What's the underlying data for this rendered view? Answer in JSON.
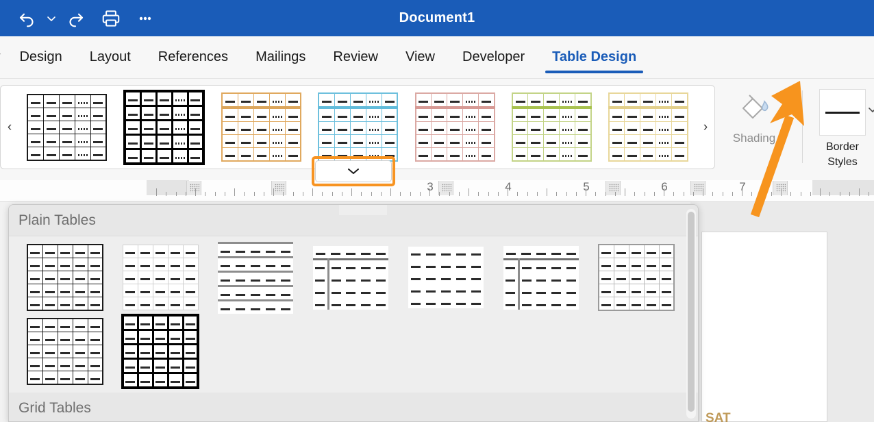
{
  "titlebar": {
    "document_title": "Document1",
    "background_color": "#1a5cb8",
    "quick_access": [
      {
        "name": "undo-icon",
        "label": "Undo"
      },
      {
        "name": "undo-dropdown-icon",
        "label": "Undo options"
      },
      {
        "name": "redo-icon",
        "label": "Redo"
      },
      {
        "name": "print-icon",
        "label": "Print"
      },
      {
        "name": "more-commands-icon",
        "label": "More"
      }
    ]
  },
  "tabs": {
    "active": "Table Design",
    "items": [
      {
        "label": "w",
        "partial": true
      },
      {
        "label": "Design",
        "partial": false
      },
      {
        "label": "Layout",
        "partial": false
      },
      {
        "label": "References",
        "partial": false
      },
      {
        "label": "Mailings",
        "partial": false
      },
      {
        "label": "Review",
        "partial": false
      },
      {
        "label": "View",
        "partial": false
      },
      {
        "label": "Developer",
        "partial": false
      },
      {
        "label": "Table Design",
        "partial": false
      }
    ],
    "accent_color": "#1a5cb8"
  },
  "ribbon": {
    "gallery": {
      "prev_arrow": "‹",
      "next_arrow": "›",
      "more_chevron": "⌄",
      "thumbnails": [
        {
          "name": "table-style-grid-plain",
          "border_color": "#1a1a1a",
          "band_color": "",
          "heavy": false
        },
        {
          "name": "table-style-grid-bold",
          "border_color": "#000000",
          "band_color": "",
          "heavy": true
        },
        {
          "name": "table-style-orange",
          "border_color": "#e0a95f",
          "band_color": "#dca65c",
          "heavy": false
        },
        {
          "name": "table-style-blue",
          "border_color": "#6ec0dd",
          "band_color": "#62bcdb",
          "heavy": false
        },
        {
          "name": "table-style-red",
          "border_color": "#dba9a4",
          "band_color": "#d79a95",
          "heavy": false
        },
        {
          "name": "table-style-green",
          "border_color": "#c3d487",
          "band_color": "#a8c24f",
          "heavy": false
        },
        {
          "name": "table-style-yellow",
          "border_color": "#e8d79a",
          "band_color": "#e3d08b",
          "heavy": false
        }
      ]
    },
    "shading": {
      "label": "Shading",
      "icon": "paint-bucket-icon",
      "disabled": true
    },
    "border_styles": {
      "label_line1": "Border",
      "label_line2": "Styles",
      "chevron": "⌄",
      "swatch": "solid-line"
    }
  },
  "ruler": {
    "numbers": [
      "3",
      "4",
      "5",
      "6",
      "7"
    ],
    "unit": "inches"
  },
  "dropdown": {
    "sections": [
      {
        "title": "Plain Tables",
        "rows": [
          [
            {
              "name": "plain-table-1",
              "variant": "grid-black"
            },
            {
              "name": "plain-table-2",
              "variant": "grid-grey"
            },
            {
              "name": "plain-table-3",
              "variant": "rows-grey"
            },
            {
              "name": "plain-table-4",
              "variant": "first-col-left"
            },
            {
              "name": "plain-table-5",
              "variant": "banded-plain"
            },
            {
              "name": "plain-table-6",
              "variant": "header-firstcol"
            },
            {
              "name": "plain-table-7",
              "variant": "grid-light"
            }
          ],
          [
            {
              "name": "plain-table-8",
              "variant": "grid-black"
            },
            {
              "name": "plain-table-9",
              "variant": "grid-heavy"
            }
          ]
        ]
      },
      {
        "title": "Grid Tables",
        "rows": []
      }
    ]
  },
  "document": {
    "visible_text": "SAT"
  },
  "annotation": {
    "arrow_color": "#f7941e",
    "highlight_color": "#f79321",
    "target": "table-styles-more-button"
  }
}
